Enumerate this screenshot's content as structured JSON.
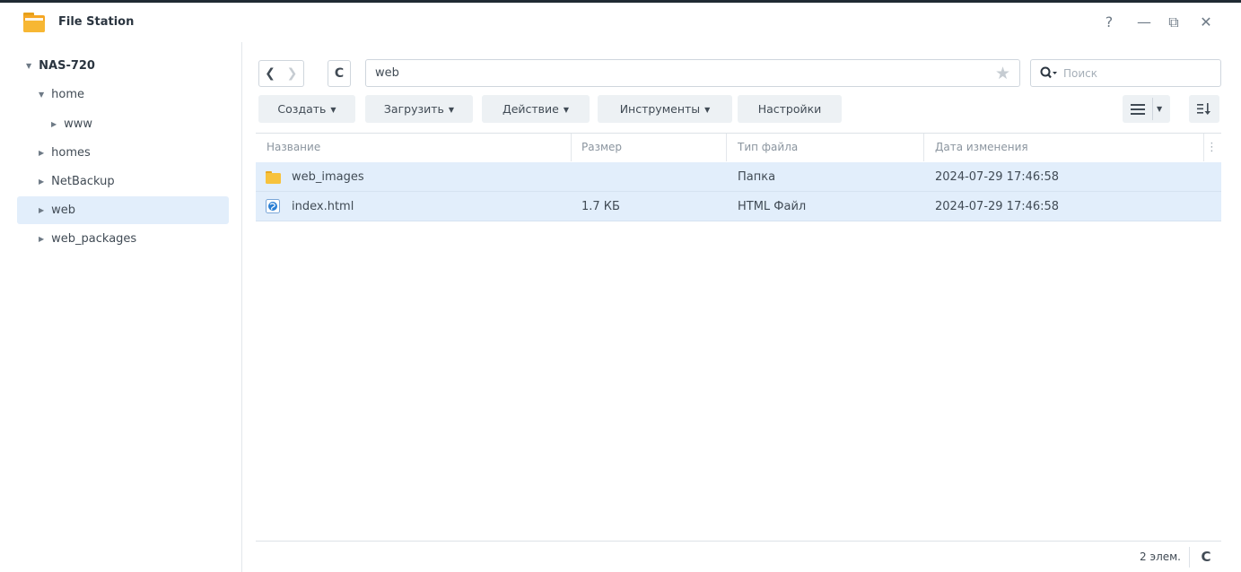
{
  "window": {
    "title": "File Station",
    "help_label": "?",
    "minimize_label": "—",
    "restore_label": "⧉",
    "close_label": "✕"
  },
  "sidebar": {
    "items": [
      {
        "label": "NAS-720",
        "arrow": "▼"
      },
      {
        "label": "home",
        "arrow": "▼"
      },
      {
        "label": "www",
        "arrow": "▶"
      },
      {
        "label": "homes",
        "arrow": "▶"
      },
      {
        "label": "NetBackup",
        "arrow": "▶"
      },
      {
        "label": "web",
        "arrow": "▶"
      },
      {
        "label": "web_packages",
        "arrow": "▶"
      }
    ]
  },
  "navigation": {
    "back_label": "❮",
    "forward_label": "❯",
    "refresh_label": "C",
    "path": "web",
    "favorite_icon": "★"
  },
  "search": {
    "placeholder": "Поиск"
  },
  "toolbar": {
    "create_label": "Создать",
    "upload_label": "Загрузить",
    "action_label": "Действие",
    "tools_label": "Инструменты",
    "settings_label": "Настройки",
    "caret": "▼"
  },
  "table": {
    "headers": {
      "name": "Название",
      "size": "Размер",
      "type": "Тип файла",
      "modified": "Дата изменения"
    },
    "column_menu_icon": "⋮",
    "rows": [
      {
        "name": "web_images",
        "size": "",
        "type": "Папка",
        "modified": "2024-07-29 17:46:58",
        "icon": "folder-icon"
      },
      {
        "name": "index.html",
        "size": "1.7 КБ",
        "type": "HTML Файл",
        "modified": "2024-07-29 17:46:58",
        "icon": "html-file-icon"
      }
    ]
  },
  "status": {
    "count": "2 элем.",
    "refresh_label": "C"
  },
  "colors": {
    "selection": "#e2eefb",
    "button_bg": "#edf1f4",
    "folder": "#f7c23c",
    "accent": "#0086e5"
  }
}
